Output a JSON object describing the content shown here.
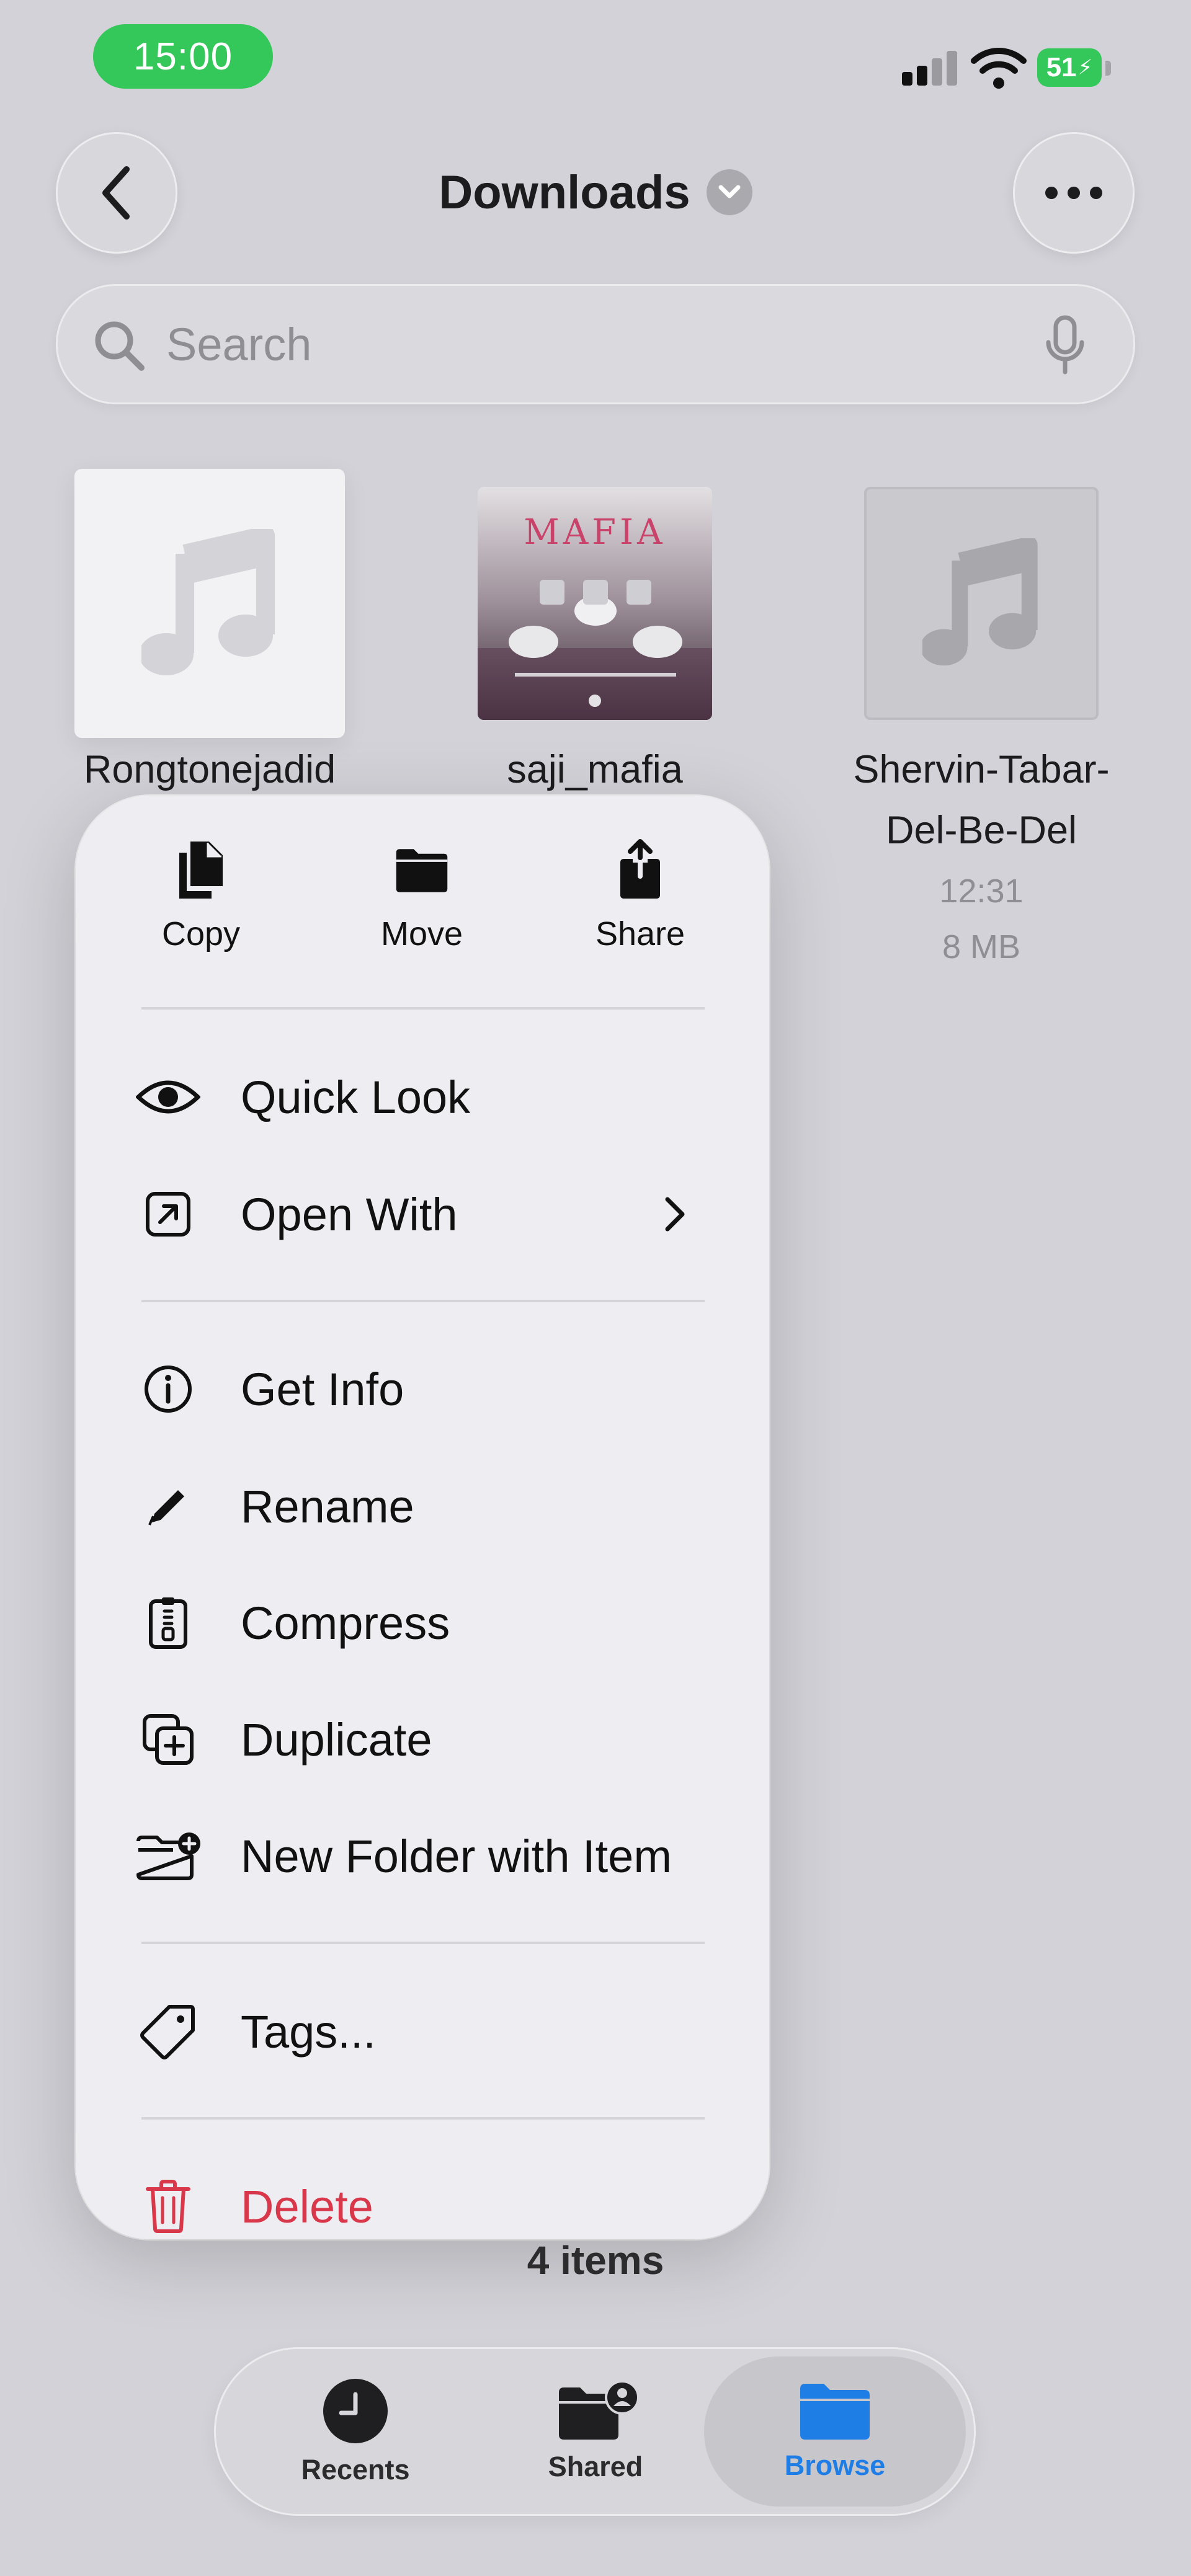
{
  "status_bar": {
    "time": "15:00",
    "battery": "51"
  },
  "nav": {
    "title": "Downloads"
  },
  "search": {
    "placeholder": "Search"
  },
  "files": [
    {
      "name": "Rongtonejadid"
    },
    {
      "name": "saji_mafia",
      "artwork_text": "MAFIA"
    },
    {
      "name_line1": "Shervin-Tabar-",
      "name_line2": "Del-Be-Del",
      "time": "12:31",
      "size": "8 MB"
    }
  ],
  "context_menu": {
    "quick_actions": [
      {
        "label": "Copy",
        "icon": "copy-icon"
      },
      {
        "label": "Move",
        "icon": "folder-icon"
      },
      {
        "label": "Share",
        "icon": "share-icon"
      }
    ],
    "items": {
      "quick_look": "Quick Look",
      "open_with": "Open With",
      "get_info": "Get Info",
      "rename": "Rename",
      "compress": "Compress",
      "duplicate": "Duplicate",
      "new_folder_with_item": "New Folder with Item",
      "tags": "Tags...",
      "delete": "Delete"
    }
  },
  "footer": {
    "items_count": "4 items"
  },
  "tabbar": {
    "tabs": [
      {
        "label": "Recents",
        "icon": "clock-icon"
      },
      {
        "label": "Shared",
        "icon": "shared-folder-icon"
      },
      {
        "label": "Browse",
        "icon": "folder-icon",
        "active": true
      }
    ]
  },
  "colors": {
    "accent": "#1f7ee6",
    "destructive": "#d8384a",
    "status_green": "#34c759"
  }
}
